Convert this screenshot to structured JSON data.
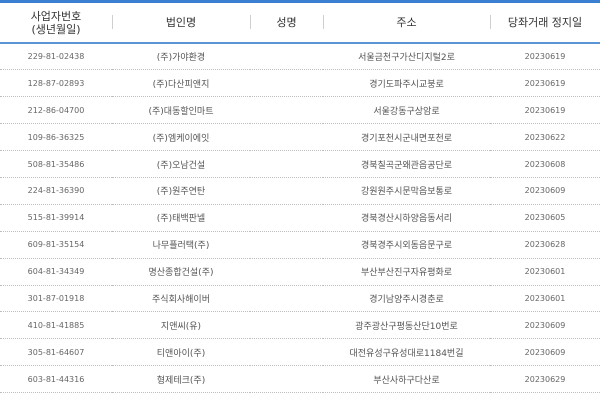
{
  "headers": {
    "biz_no_line1": "사업자번호",
    "biz_no_line2": "(생년월일)",
    "corp_name": "법인명",
    "person_name": "성명",
    "address": "주소",
    "suspend_date": "당좌거래 정지일"
  },
  "rows": [
    {
      "biz_no": "229-81-02438",
      "corp": "(주)가야환경",
      "name": "",
      "addr": "서울금천구가산디지털2로",
      "date": "20230619"
    },
    {
      "biz_no": "128-87-02893",
      "corp": "(주)다산피앤지",
      "name": "",
      "addr": "경기도파주시교붕로",
      "date": "20230619"
    },
    {
      "biz_no": "212-86-04700",
      "corp": "(주)대동할인마트",
      "name": "",
      "addr": "서울강동구상암로",
      "date": "20230619"
    },
    {
      "biz_no": "109-86-36325",
      "corp": "(주)엠케이에잇",
      "name": "",
      "addr": "경기포천시군내면포천로",
      "date": "20230622"
    },
    {
      "biz_no": "508-81-35486",
      "corp": "(주)오남건설",
      "name": "",
      "addr": "경북칠곡군왜관읍공단로",
      "date": "20230608"
    },
    {
      "biz_no": "224-81-36390",
      "corp": "(주)원주연탄",
      "name": "",
      "addr": "강원원주시문막읍보통로",
      "date": "20230609"
    },
    {
      "biz_no": "515-81-39914",
      "corp": "(주)태백판넬",
      "name": "",
      "addr": "경북경산시하양읍동서리",
      "date": "20230605"
    },
    {
      "biz_no": "609-81-35154",
      "corp": "나무플러택(주)",
      "name": "",
      "addr": "경북경주시외동읍문구로",
      "date": "20230628"
    },
    {
      "biz_no": "604-81-34349",
      "corp": "명산종합건설(주)",
      "name": "",
      "addr": "부산부산진구자유평화로",
      "date": "20230601"
    },
    {
      "biz_no": "301-87-01918",
      "corp": "주식회사해이버",
      "name": "",
      "addr": "경기남양주시경춘로",
      "date": "20230601"
    },
    {
      "biz_no": "410-81-41885",
      "corp": "지앤씨(유)",
      "name": "",
      "addr": "광주광산구평동산단10번로",
      "date": "20230609"
    },
    {
      "biz_no": "305-81-64607",
      "corp": "티앤아이(주)",
      "name": "",
      "addr": "대전유성구유성대로1184번길",
      "date": "20230609"
    },
    {
      "biz_no": "603-81-44316",
      "corp": "형제테크(주)",
      "name": "",
      "addr": "부산사하구다산로",
      "date": "20230629"
    }
  ]
}
